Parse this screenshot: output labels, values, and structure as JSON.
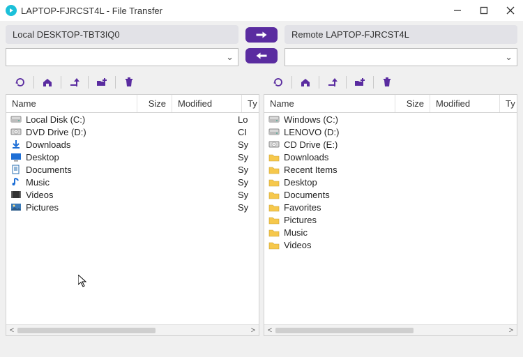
{
  "window": {
    "title": "LAPTOP-FJRCST4L - File Transfer"
  },
  "local": {
    "label": "Local  DESKTOP-TBT3IQ0",
    "columns": {
      "name": "Name",
      "size": "Size",
      "modified": "Modified",
      "type": "Ty"
    },
    "items": [
      {
        "icon": "disk",
        "label": "Local Disk (C:)",
        "type": "Lo"
      },
      {
        "icon": "dvd",
        "label": "DVD Drive (D:)",
        "type": "CI"
      },
      {
        "icon": "download",
        "label": "Downloads",
        "type": "Sy"
      },
      {
        "icon": "desktop",
        "label": "Desktop",
        "type": "Sy"
      },
      {
        "icon": "folder-docs",
        "label": "Documents",
        "type": "Sy"
      },
      {
        "icon": "music",
        "label": "Music",
        "type": "Sy"
      },
      {
        "icon": "video",
        "label": "Videos",
        "type": "Sy"
      },
      {
        "icon": "picture",
        "label": "Pictures",
        "type": "Sy"
      }
    ]
  },
  "remote": {
    "label": "Remote  LAPTOP-FJRCST4L",
    "columns": {
      "name": "Name",
      "size": "Size",
      "modified": "Modified",
      "type": "Ty"
    },
    "items": [
      {
        "icon": "disk",
        "label": "Windows (C:)",
        "type": ""
      },
      {
        "icon": "disk",
        "label": "LENOVO (D:)",
        "type": ""
      },
      {
        "icon": "dvd",
        "label": "CD Drive (E:)",
        "type": ""
      },
      {
        "icon": "folder",
        "label": "Downloads",
        "type": ""
      },
      {
        "icon": "folder",
        "label": "Recent Items",
        "type": ""
      },
      {
        "icon": "folder",
        "label": "Desktop",
        "type": ""
      },
      {
        "icon": "folder",
        "label": "Documents",
        "type": ""
      },
      {
        "icon": "folder",
        "label": "Favorites",
        "type": ""
      },
      {
        "icon": "folder",
        "label": "Pictures",
        "type": ""
      },
      {
        "icon": "folder",
        "label": "Music",
        "type": ""
      },
      {
        "icon": "folder",
        "label": "Videos",
        "type": ""
      }
    ]
  },
  "toolbar_icons": [
    "refresh",
    "home",
    "up",
    "newfolder",
    "delete"
  ]
}
